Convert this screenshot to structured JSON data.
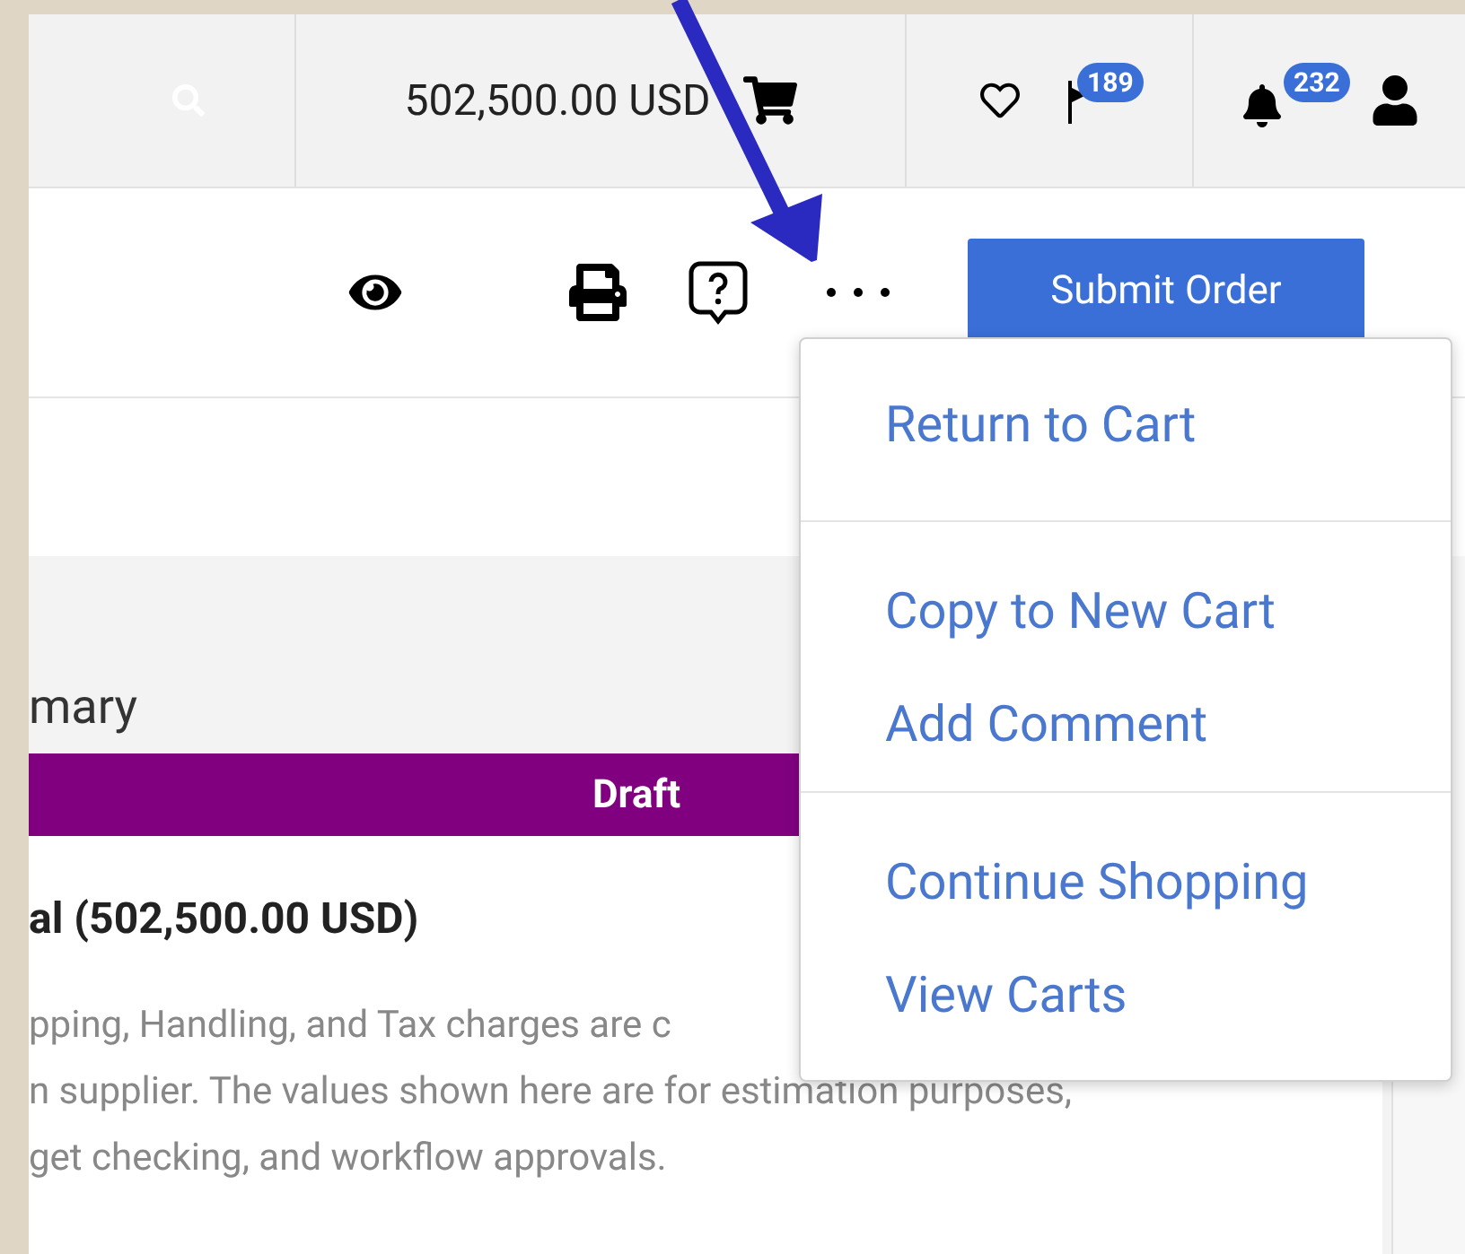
{
  "top_bar": {
    "cart_total": "502,500.00 USD",
    "flag_badge": "189",
    "notification_badge": "232"
  },
  "toolbar": {
    "submit_button": "Submit Order"
  },
  "menu": {
    "groups": [
      [
        "Return to Cart"
      ],
      [
        "Copy to New Cart",
        "Add Comment"
      ],
      [
        "Continue Shopping",
        "View Carts"
      ]
    ]
  },
  "summary": {
    "title": "mary",
    "status": "Draft",
    "total": "al (502,500.00 USD)",
    "note_lines": [
      "pping, Handling, and Tax charges are c",
      "n supplier. The values shown here are for estimation purposes,",
      "get checking, and workflow approvals."
    ]
  }
}
